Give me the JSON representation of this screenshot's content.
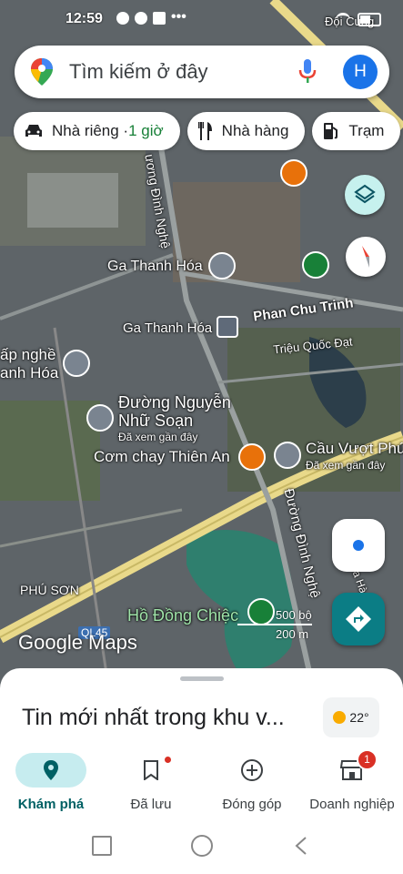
{
  "status_bar": {
    "time": "12:59",
    "dots": "•••"
  },
  "search": {
    "placeholder": "Tìm kiếm ở đây",
    "avatar_letter": "H"
  },
  "chips": [
    {
      "icon": "car-icon",
      "label": "Nhà riêng · ",
      "extra": "1 giờ"
    },
    {
      "icon": "restaurant-icon",
      "label": "Nhà hàng",
      "extra": ""
    },
    {
      "icon": "gas-station-icon",
      "label": "Trạm",
      "extra": ""
    }
  ],
  "map_labels": {
    "doi_cung": "Đội Cung",
    "ga1": "Ga Thanh Hóa",
    "ga2": "Ga Thanh Hóa",
    "phan_chu_trinh": "Phan Chu Trinh",
    "trieu_quoc_dat": "Triệu Quốc Đạt",
    "cap_nghe": "ấp nghề",
    "thanh_hoa": "anh Hóa",
    "nguyen_nhu_soan": "Đường Nguyễn",
    "nguyen_nhu_soan2": "Nhữ Soạn",
    "da_xem1": "Đã xem gần đây",
    "com_chay": "Cơm chay Thiên An",
    "cau_vuot": "Cầu Vượt Phú",
    "da_xem2": "Đã xem gần đây",
    "duong_dinh_nghe": "Đường Đình Nghệ",
    "duong_dinh_nghe_top": "ương Đình Nghệ",
    "phu_son": "PHÚ SƠN",
    "ho_dong_chiec": "Hồ Đồng Chiệc",
    "ql45": "QL45",
    "ha_linh": "a Hà"
  },
  "scale": {
    "top": "500 bộ",
    "bottom": "200 m"
  },
  "google_logo": "Google Maps",
  "sheet": {
    "title": "Tin mới nhất trong khu v...",
    "weather": "22°"
  },
  "nav": [
    {
      "label": "Khám phá",
      "icon": "explore-pin-icon",
      "active": true
    },
    {
      "label": "Đã lưu",
      "icon": "bookmark-icon",
      "active": false
    },
    {
      "label": "Đóng góp",
      "icon": "add-circle-icon",
      "active": false
    },
    {
      "label": "Doanh nghiệp",
      "icon": "store-icon",
      "active": false,
      "badge": "1"
    }
  ],
  "colors": {
    "accent": "#1a73e8",
    "teal": "#0b7d85",
    "active_nav_bg": "#c6ecef",
    "green_text": "#188038"
  }
}
